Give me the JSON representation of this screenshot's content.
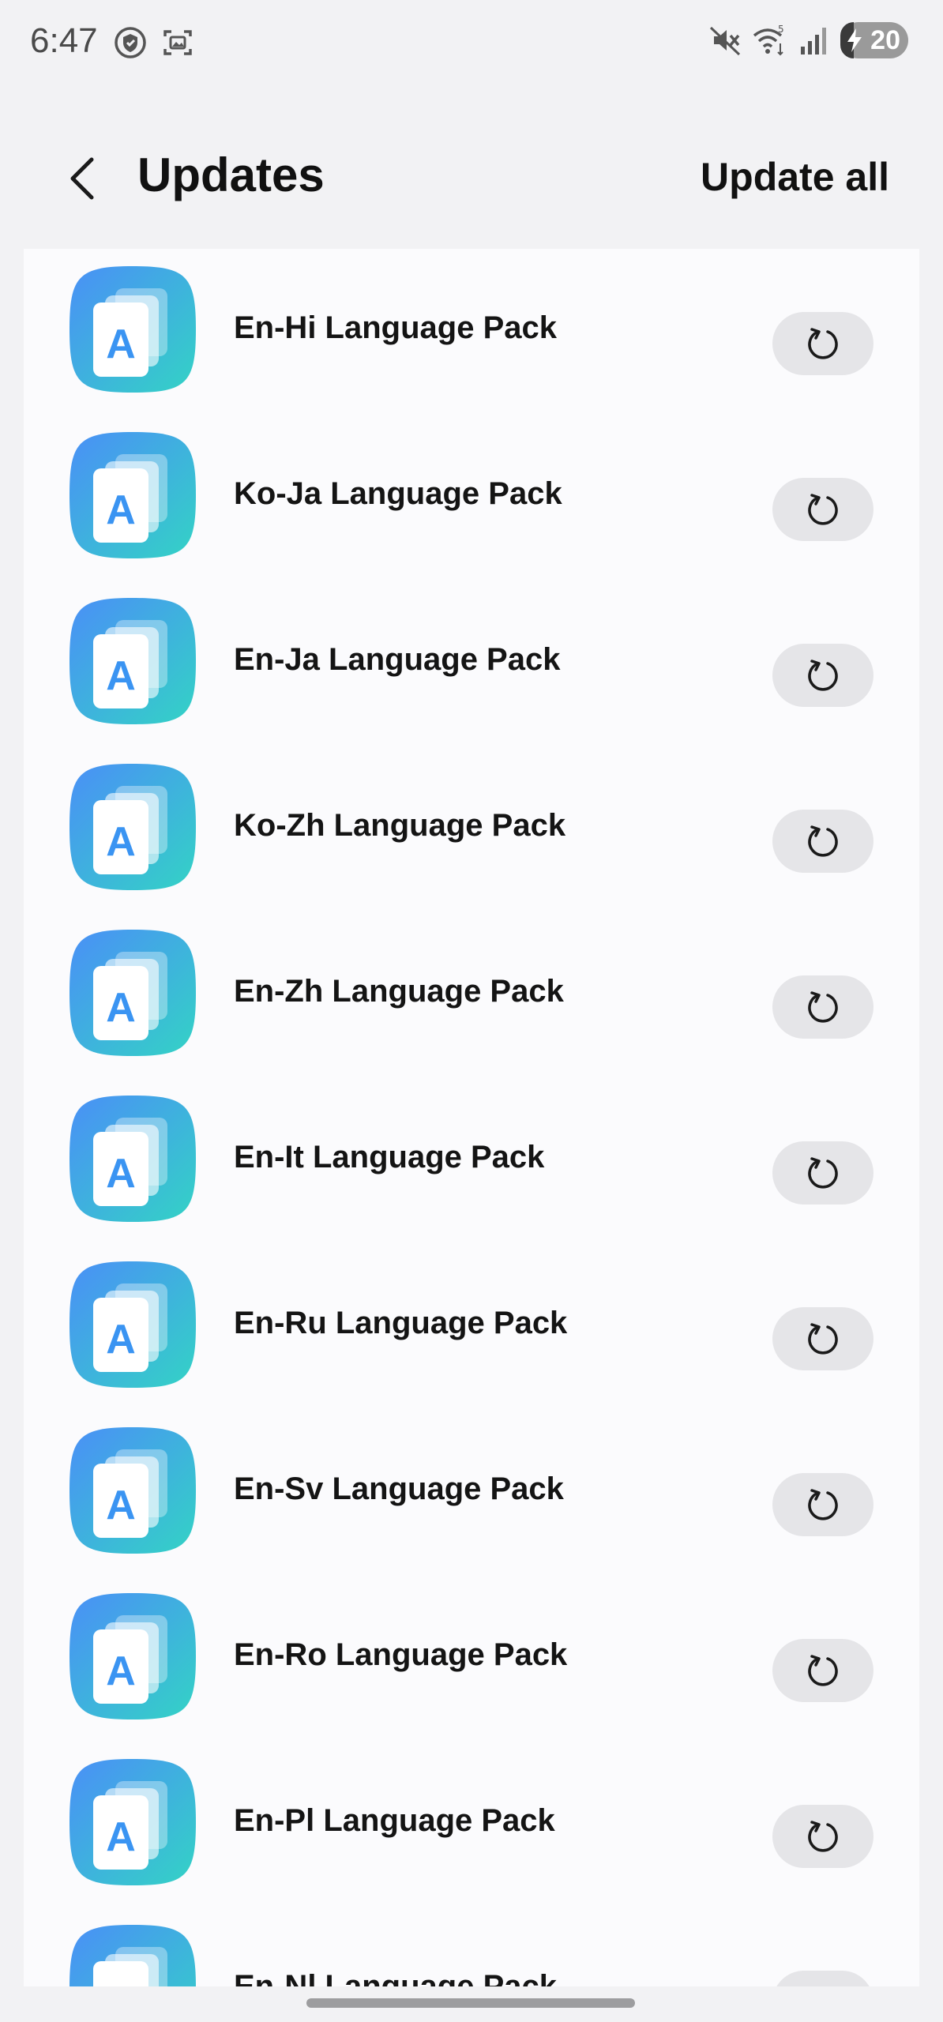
{
  "status_bar": {
    "time": "6:47",
    "battery_level": "20",
    "battery_fraction": 0.2,
    "left_icons": [
      "shield-icon",
      "screenshot-icon"
    ],
    "right_icons": [
      "mute-icon",
      "wifi-icon",
      "signal-icon",
      "battery-charging-icon"
    ]
  },
  "header": {
    "title": "Updates",
    "update_all_label": "Update all",
    "back_icon": "chevron-left-icon"
  },
  "items": [
    {
      "name": "En-Hi Language Pack",
      "icon": "language-pack-icon"
    },
    {
      "name": "Ko-Ja Language Pack",
      "icon": "language-pack-icon"
    },
    {
      "name": "En-Ja Language Pack",
      "icon": "language-pack-icon"
    },
    {
      "name": "Ko-Zh Language Pack",
      "icon": "language-pack-icon"
    },
    {
      "name": "En-Zh Language Pack",
      "icon": "language-pack-icon"
    },
    {
      "name": "En-It Language Pack",
      "icon": "language-pack-icon"
    },
    {
      "name": "En-Ru Language Pack",
      "icon": "language-pack-icon"
    },
    {
      "name": "En-Sv Language Pack",
      "icon": "language-pack-icon"
    },
    {
      "name": "En-Ro Language Pack",
      "icon": "language-pack-icon"
    },
    {
      "name": "En-Pl Language Pack",
      "icon": "language-pack-icon"
    },
    {
      "name": "En-Nl Language Pack",
      "icon": "language-pack-icon"
    }
  ],
  "app_icon_letter": "A",
  "colors": {
    "icon_gradient_start": "#4a8ff7",
    "icon_gradient_end": "#33d3c5",
    "background": "#f2f2f4",
    "card": "#fbfbfd",
    "button": "#e5e5e8"
  }
}
